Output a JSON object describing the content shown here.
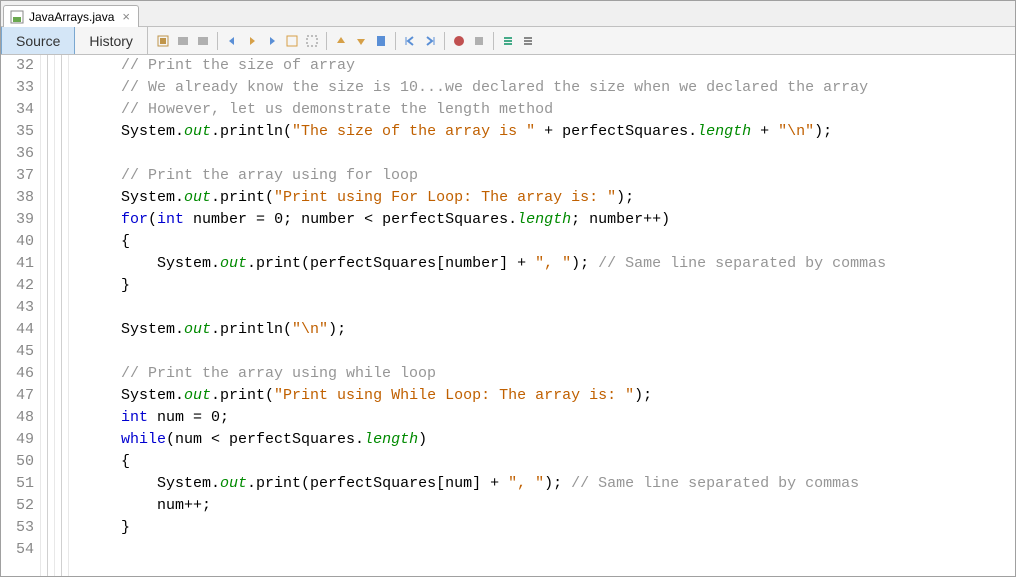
{
  "tab": {
    "filename": "JavaArrays.java",
    "close": "×"
  },
  "toolbar": {
    "source_label": "Source",
    "history_label": "History"
  },
  "gutter": {
    "start": 32,
    "end": 54
  },
  "code": {
    "lines": [
      {
        "t": "comment",
        "text": "// Print the size of array"
      },
      {
        "t": "comment",
        "text": "// We already know the size is 10...we declared the size when we declared the array"
      },
      {
        "t": "comment",
        "text": "// However, let us demonstrate the length method"
      },
      {
        "t": "stmt",
        "parts": [
          "System.",
          {
            "f": "out"
          },
          ".println(",
          {
            "s": "\"The size of the array is \""
          },
          " + perfectSquares.",
          {
            "f": "length"
          },
          " + ",
          {
            "s": "\"\\n\""
          },
          ");"
        ]
      },
      {
        "t": "blank"
      },
      {
        "t": "comment",
        "text": "// Print the array using for loop"
      },
      {
        "t": "stmt",
        "parts": [
          "System.",
          {
            "f": "out"
          },
          ".print(",
          {
            "s": "\"Print using For Loop: The array is: \""
          },
          ");"
        ]
      },
      {
        "t": "stmt",
        "parts": [
          {
            "k": "for"
          },
          "(",
          {
            "k": "int"
          },
          " number = ",
          {
            "n": "0"
          },
          "; number < perfectSquares.",
          {
            "f": "length"
          },
          "; number++)"
        ]
      },
      {
        "t": "stmt",
        "parts": [
          "{"
        ]
      },
      {
        "t": "stmt",
        "indent": 1,
        "parts": [
          "System.",
          {
            "f": "out"
          },
          ".print(perfectSquares[number] + ",
          {
            "s": "\", \""
          },
          "); ",
          {
            "c": "// Same line separated by commas"
          }
        ]
      },
      {
        "t": "stmt",
        "parts": [
          "}"
        ]
      },
      {
        "t": "blank"
      },
      {
        "t": "stmt",
        "parts": [
          "System.",
          {
            "f": "out"
          },
          ".println(",
          {
            "s": "\"\\n\""
          },
          ");"
        ]
      },
      {
        "t": "blank"
      },
      {
        "t": "comment",
        "text": "// Print the array using while loop"
      },
      {
        "t": "stmt",
        "parts": [
          "System.",
          {
            "f": "out"
          },
          ".print(",
          {
            "s": "\"Print using While Loop: The array is: \""
          },
          ");"
        ]
      },
      {
        "t": "stmt",
        "parts": [
          {
            "k": "int"
          },
          " num = ",
          {
            "n": "0"
          },
          ";"
        ]
      },
      {
        "t": "stmt",
        "parts": [
          {
            "k": "while"
          },
          "(num < perfectSquares.",
          {
            "f": "length"
          },
          ")"
        ]
      },
      {
        "t": "stmt",
        "parts": [
          "{"
        ]
      },
      {
        "t": "stmt",
        "indent": 1,
        "parts": [
          "System.",
          {
            "f": "out"
          },
          ".print(perfectSquares[num] + ",
          {
            "s": "\", \""
          },
          "); ",
          {
            "c": "// Same line separated by commas"
          }
        ]
      },
      {
        "t": "stmt",
        "indent": 1,
        "parts": [
          "num++;"
        ]
      },
      {
        "t": "stmt",
        "parts": [
          "}"
        ]
      },
      {
        "t": "blank"
      }
    ]
  }
}
